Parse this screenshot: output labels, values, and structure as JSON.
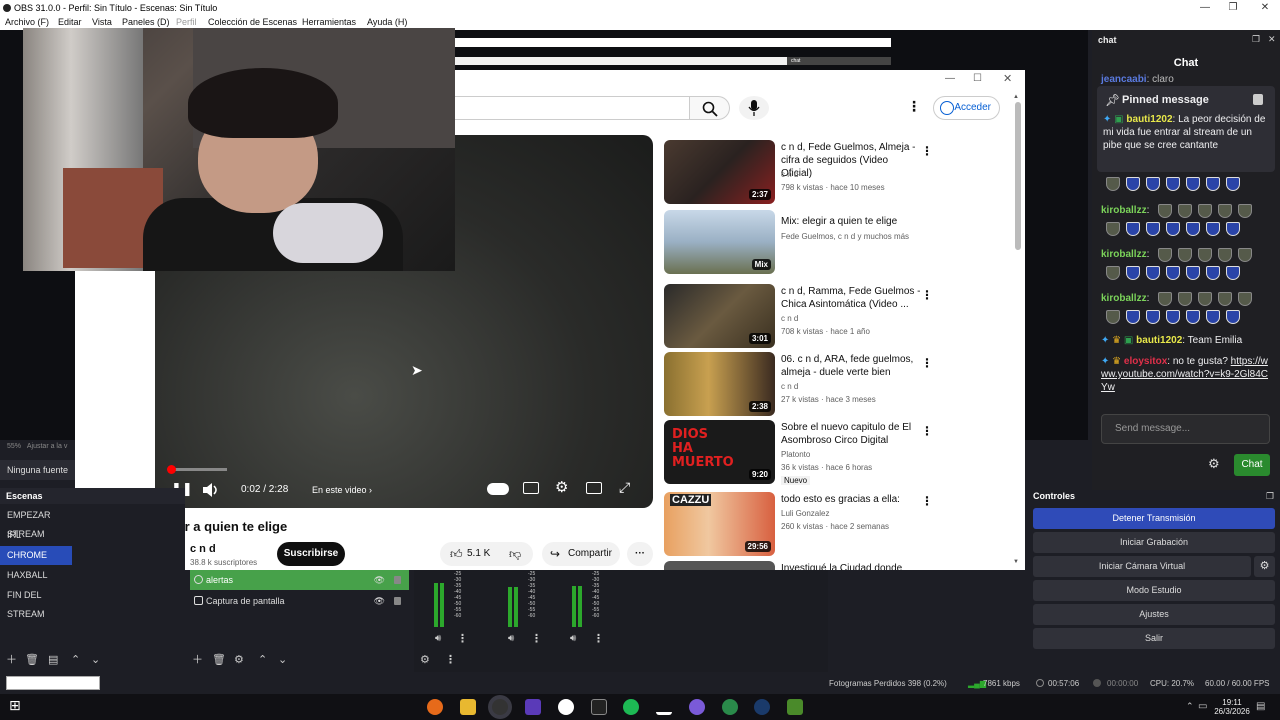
{
  "window": {
    "title": "OBS 31.0.0 - Perfil: Sin Título - Escenas: Sin Título"
  },
  "menu": [
    "Archivo (F)",
    "Editar",
    "Vista",
    "Paneles (D)",
    "Perfil",
    "Colección de Escenas",
    "Herramientas",
    "Ayuda (H)"
  ],
  "bg_window": {
    "chat_label": "chat"
  },
  "youtube": {
    "signin_label": "Acceder",
    "player": {
      "time": "0:02 / 2:28",
      "chapter_label": "En este video",
      "progress_fraction": 0.014
    },
    "video_title": "elegir a quien te elige",
    "channel": {
      "name": "c n d",
      "subs": "38.8 k suscriptores",
      "subscribe_label": "Suscribirse"
    },
    "actions": {
      "likes": "5.1 K",
      "share_label": "Compartir"
    },
    "recommendations": [
      {
        "title": "c n d, Fede Guelmos, Almeja - cifra de seguidos (Video Oficial)",
        "channel": "c n d",
        "meta": "798 k vistas · hace 10 meses",
        "duration": "2:37",
        "badge": ""
      },
      {
        "title": "Mix: elegir a quien te elige",
        "channel": "Fede Guelmos, c n d y muchos más",
        "meta": "",
        "duration": "Mix",
        "badge": ""
      },
      {
        "title": "c n d, Ramma, Fede Guelmos - Chica Asintomática (Video ...",
        "channel": "c n d",
        "meta": "708 k vistas · hace 1 año",
        "duration": "3:01",
        "badge": ""
      },
      {
        "title": "06. c n d, ARA, fede guelmos, almeja - duele verte bien",
        "channel": "c n d",
        "meta": "27 k vistas · hace 3 meses",
        "duration": "2:38",
        "badge": ""
      },
      {
        "title": "Sobre el nuevo capitulo de El Asombroso Circo Digital",
        "channel": "Platonto",
        "meta": "36 k vistas · hace 6 horas",
        "duration": "9:20",
        "badge": "Nuevo"
      },
      {
        "title": "todo esto es gracias a ella:",
        "channel": "Luli Gonzalez",
        "meta": "260 k vistas · hace 2 semanas",
        "duration": "29:56",
        "badge": ""
      },
      {
        "title": "Investigué la Ciudad donde",
        "channel": "",
        "meta": "",
        "duration": "",
        "badge": ""
      }
    ],
    "thumb_texts": {
      "dios": "DIOS HA MUERTO",
      "cazzu": "CAZZU"
    }
  },
  "preview": {
    "zoom": "55%",
    "zoom_hint": "Ajustar a la v",
    "no_source": "Ninguna fuente s"
  },
  "scenes": {
    "header": "Escenas",
    "items": [
      "EMPEZAR STREAM",
      "IRL",
      "CHROME",
      "HAXBALL",
      "FIN DEL STREAM"
    ],
    "selected": "CHROME"
  },
  "sources": {
    "items": [
      {
        "name": "alertas",
        "selected": true
      },
      {
        "name": "Captura de pantalla",
        "selected": false
      }
    ]
  },
  "mixer": {
    "scale": [
      "-25",
      "-30",
      "-35",
      "-40",
      "-45",
      "-50",
      "-55",
      "-60"
    ],
    "levels": [
      0.78,
      0.72,
      0.74
    ]
  },
  "controls": {
    "header": "Controles",
    "buttons": [
      "Detener Transmisión",
      "Iniciar Grabación",
      "Iniciar Cámara Virtual",
      "Modo Estudio",
      "Ajustes",
      "Salir"
    ]
  },
  "chat": {
    "dock_title": "chat",
    "header": "Chat",
    "top_msg": {
      "user": "jeancaabi",
      "text": ": claro"
    },
    "pinned": {
      "title": "Pinned message",
      "user": "bauti1202",
      "text": ": La peor decisión de mi vida fue entrar al stream de un pibe que se cree cantante"
    },
    "messages": [
      {
        "user": "kiroballzz",
        "text": ":"
      },
      {
        "user": "kiroballzz",
        "text": ":"
      },
      {
        "user": "kiroballzz",
        "text": ":"
      },
      {
        "user": "bauti1202",
        "text": ": Team Emilia"
      },
      {
        "user": "eloysitox",
        "text": ": no te gusta? ",
        "link": "https://www.youtube.com/watch?v=k9-2Gl84CYw"
      }
    ],
    "input_placeholder": "Send message...",
    "send_label": "Chat"
  },
  "status": {
    "dropped": "Fotogramas Perdidos 398 (0.2%)",
    "bitrate": "7861 kbps",
    "live_time": "00:57:06",
    "rec_time": "00:00:00",
    "cpu": "CPU: 20.7%",
    "fps": "60.00 / 60.00 FPS"
  },
  "taskbar": {
    "time": "19:11",
    "date": "26/3/2026"
  },
  "colors": {
    "accent": "#284cb8",
    "source_sel": "#47a14a",
    "chat_btn": "#2a8a2e",
    "yt_red": "#ff0000"
  }
}
